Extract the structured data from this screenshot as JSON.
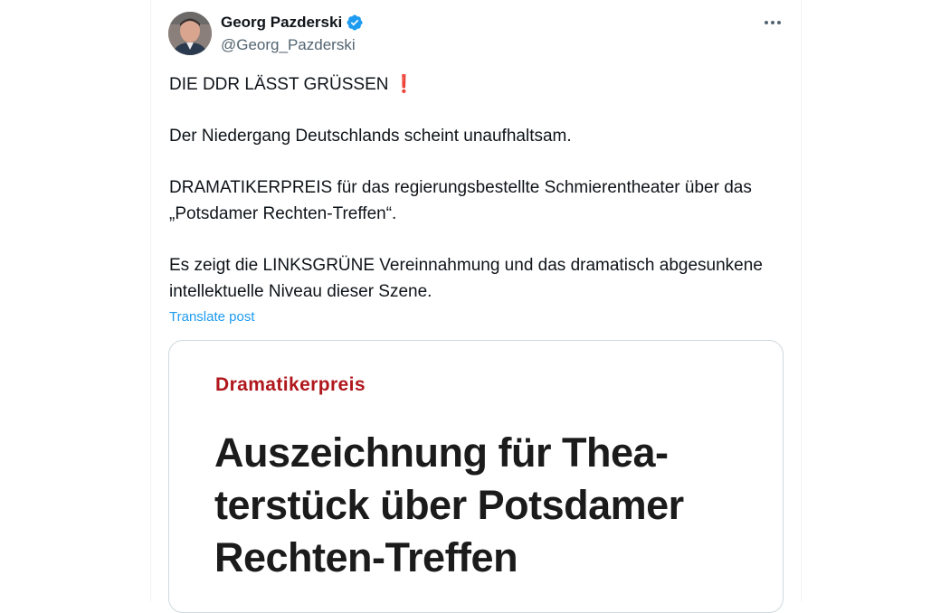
{
  "author": {
    "name": "Georg Pazderski",
    "handle": "@Georg_Pazderski",
    "verified": true
  },
  "icons": {
    "verified": "verified-badge-icon",
    "more": "more-horizontal-icon",
    "exclaim": "red-exclamation-icon"
  },
  "colors": {
    "accent": "#1d9bf0",
    "kicker": "#b0171c",
    "text": "#0f1419",
    "muted": "#536471"
  },
  "tweet": {
    "line1": "DIE DDR LÄSST GRÜSSEN",
    "line1_emoji": "❗",
    "paragraph2": "Der Niedergang Deutschlands scheint unaufhaltsam.",
    "paragraph3": "DRAMATIKERPREIS für das regierungsbestellte Schmierentheater über das „Potsdamer Rechten-Treffen“.",
    "paragraph4": "Es zeigt die LINKSGRÜNE Vereinnahmung und das dramatisch abgesunkene intellektuelle Niveau dieser Szene.",
    "translate_label": "Translate post"
  },
  "card": {
    "kicker": "Dramatikerpreis",
    "headline": "Auszeichnung für Thea­terstück über Potsdamer Rechten-Treffen"
  }
}
